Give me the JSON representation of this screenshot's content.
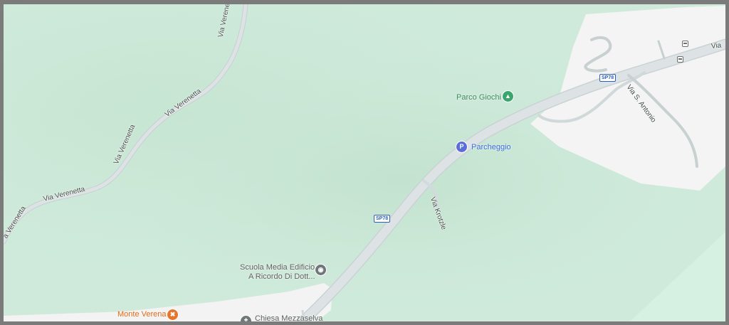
{
  "map": {
    "colors": {
      "forest": "#cfeadb",
      "forest_dark": "#bfe0cc",
      "developed": "#f4f5f4",
      "road": "#dde3e4",
      "road_edge": "#c9d2d4",
      "frame": "#7b7b7b"
    },
    "streets": {
      "via_verenetta": "Via Verenetta",
      "via_verenetta_partial": "a Verenetta",
      "via_s_antonio": "Via S. Antonio",
      "via_krotzle": "Via Krotzle",
      "via_partial": "Via"
    },
    "route_shields": {
      "sp78_upper": "SP78",
      "sp78_lower": "SP78"
    },
    "pois": {
      "parco_giochi": {
        "label": "Parco Giochi",
        "icon": "tree-icon"
      },
      "parcheggio": {
        "label": "Parcheggio",
        "icon": "parking-icon",
        "glyph": "P"
      },
      "scuola": {
        "line1": "Scuola Media Edificio",
        "line2": "A Ricordo Di Dott...",
        "icon": "school-icon"
      },
      "monte_verena": {
        "label": "Monte Verena",
        "icon": "restaurant-icon"
      },
      "chiesa": {
        "label": "Chiesa Mezzaselva",
        "icon": "church-icon"
      }
    },
    "transit": {
      "icon": "bus-stop-icon"
    }
  }
}
